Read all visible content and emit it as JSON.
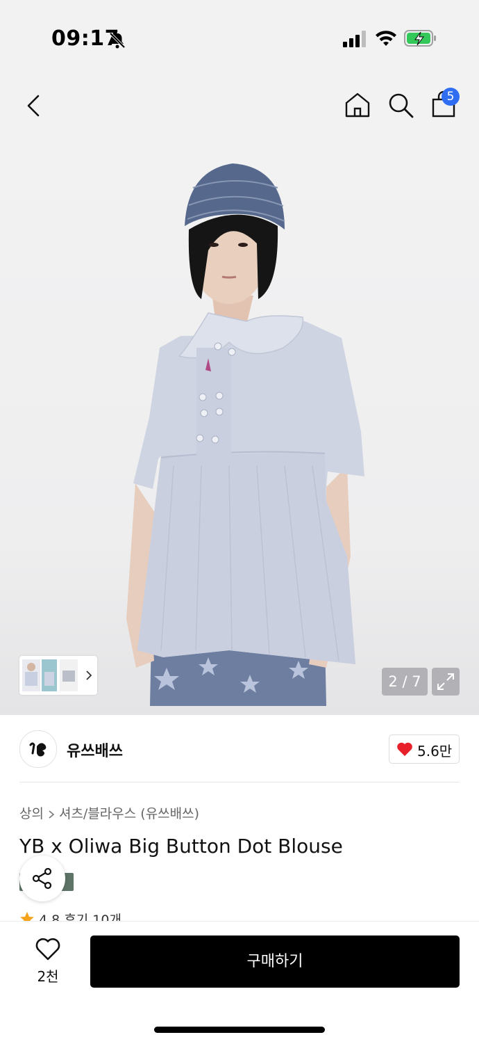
{
  "status_bar": {
    "time": "09:17"
  },
  "nav": {
    "cart_badge": "5"
  },
  "gallery": {
    "counter": "2 / 7"
  },
  "brand": {
    "name": "유쓰배쓰",
    "likes": "5.6만"
  },
  "breadcrumb": {
    "category": "상의",
    "subcategory": "셔츠/블라우스 (유쓰배쓰)"
  },
  "product": {
    "title": "YB x Oliwa Big Button Dot Blouse"
  },
  "rating": {
    "score": "4.8",
    "reviews": "후기 10개"
  },
  "bottom": {
    "wish_count": "2천",
    "buy_label": "구매하기"
  },
  "colors": {
    "accent_blue": "#2f6ef2",
    "heart_red": "#e8202a",
    "buy_button": "#000000",
    "star": "#f6a21a",
    "tag_green": "#5e7466"
  },
  "icons": [
    "bell-slash-icon",
    "signal-icon",
    "wifi-icon",
    "battery-charging-icon",
    "back-icon",
    "home-icon",
    "search-icon",
    "shopping-bag-icon",
    "chevron-right-icon",
    "expand-icon",
    "heart-icon",
    "share-icon",
    "star-icon"
  ]
}
